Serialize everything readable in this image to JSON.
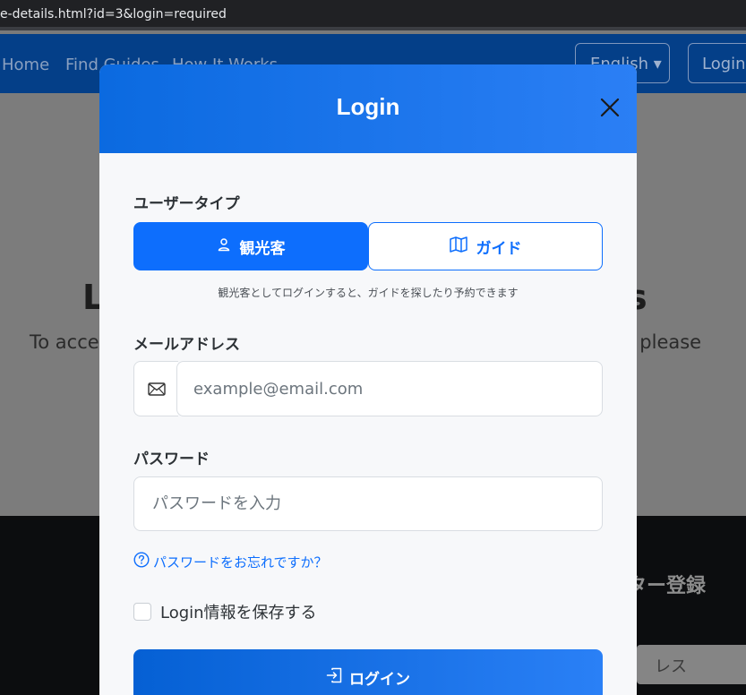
{
  "browser": {
    "url": "e-details.html?id=3&login=required"
  },
  "background": {
    "nav": {
      "links": [
        "Home",
        "Find Guides",
        "How It Works"
      ],
      "language": "English",
      "login": "Login"
    },
    "hero": {
      "heading_left": "L",
      "heading_right": "s",
      "text_left": "To acces",
      "text_right": "s, please"
    },
    "footer": {
      "newsletter_title": "ター登録",
      "newsletter_input": "レス"
    }
  },
  "modal": {
    "title": "Login",
    "user_type_label": "ユーザータイプ",
    "user_types": [
      {
        "label": "観光客",
        "icon": "person-icon",
        "active": true
      },
      {
        "label": "ガイド",
        "icon": "map-icon",
        "active": false
      }
    ],
    "hint": "観光客としてログインすると、ガイドを探したり予約できます",
    "email_label": "メールアドレス",
    "email_placeholder": "example@email.com",
    "password_label": "パスワード",
    "password_placeholder": "パスワードを入力",
    "forgot_password": "パスワードをお忘れですか？",
    "remember_me": "Login情報を保存する",
    "submit": "ログイン"
  },
  "colors": {
    "primary": "#0d6efd",
    "header_gradient_start": "#0b6ae0",
    "header_gradient_end": "#2b7ff5"
  }
}
